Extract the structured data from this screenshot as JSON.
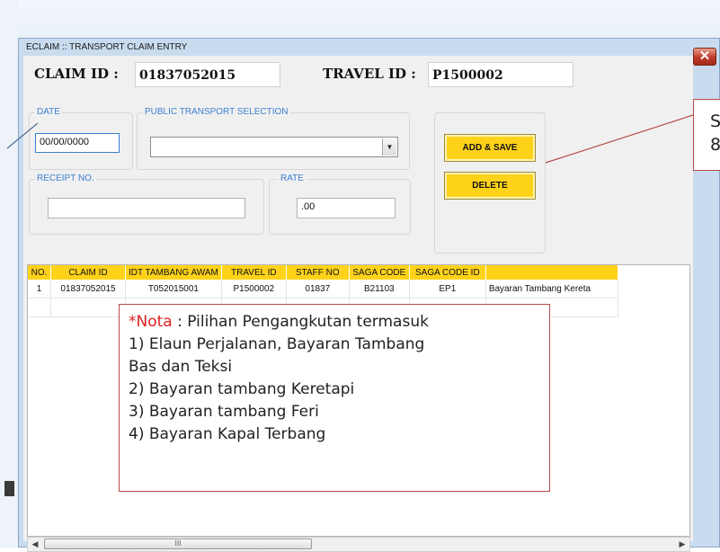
{
  "window": {
    "title": "ECLAIM :: TRANSPORT CLAIM ENTRY"
  },
  "header": {
    "claim_id_label": "CLAIM ID :",
    "claim_id_value": "01837052015",
    "travel_id_label": "TRAVEL ID :",
    "travel_id_value": "P1500002"
  },
  "form": {
    "date_legend": "DATE",
    "date_value": "00/00/0000",
    "transport_legend": "PUBLIC TRANSPORT SELECTION",
    "transport_value": "",
    "receipt_legend": "RECEIPT NO.",
    "receipt_value": "",
    "rate_legend": "RATE",
    "rate_value": ".00"
  },
  "buttons": {
    "add_save": "ADD & SAVE",
    "delete": "DELETE"
  },
  "table": {
    "columns": [
      "NO.",
      "CLAIM ID",
      "IDT TAMBANG AWAM",
      "TRAVEL ID",
      "STAFF NO",
      "SAGA CODE",
      "SAGA CODE ID",
      ""
    ],
    "rows": [
      [
        "1",
        "01837052015",
        "T052015001",
        "P1500002",
        "01837",
        "B21103",
        "EP1",
        "Bayaran Tambang Kereta"
      ]
    ]
  },
  "scroll": {
    "left": "◀",
    "right": "▶",
    "grip": "III"
  },
  "note": {
    "marker": "*Nota",
    "line1": " : Pilihan Pengangkutan termasuk",
    "line2": "1) Elaun Perjalanan, Bayaran Tambang",
    "line3": "Bas dan Teksi",
    "line4": "2) Bayaran tambang Keretapi",
    "line5": "3) Bayaran tambang Feri",
    "line6": "4) Bayaran Kapal Terbang"
  },
  "callout": {
    "line1": "S",
    "line2": "8"
  },
  "icons": {
    "close": "close-icon",
    "dropdown": "chevron-down-icon"
  },
  "colors": {
    "accent_button": "#ffd21a",
    "legend_text": "#3c7fd1",
    "window_frame": "#c9dcef",
    "close_button": "#c0392b",
    "annotation_border": "#b94a48"
  }
}
